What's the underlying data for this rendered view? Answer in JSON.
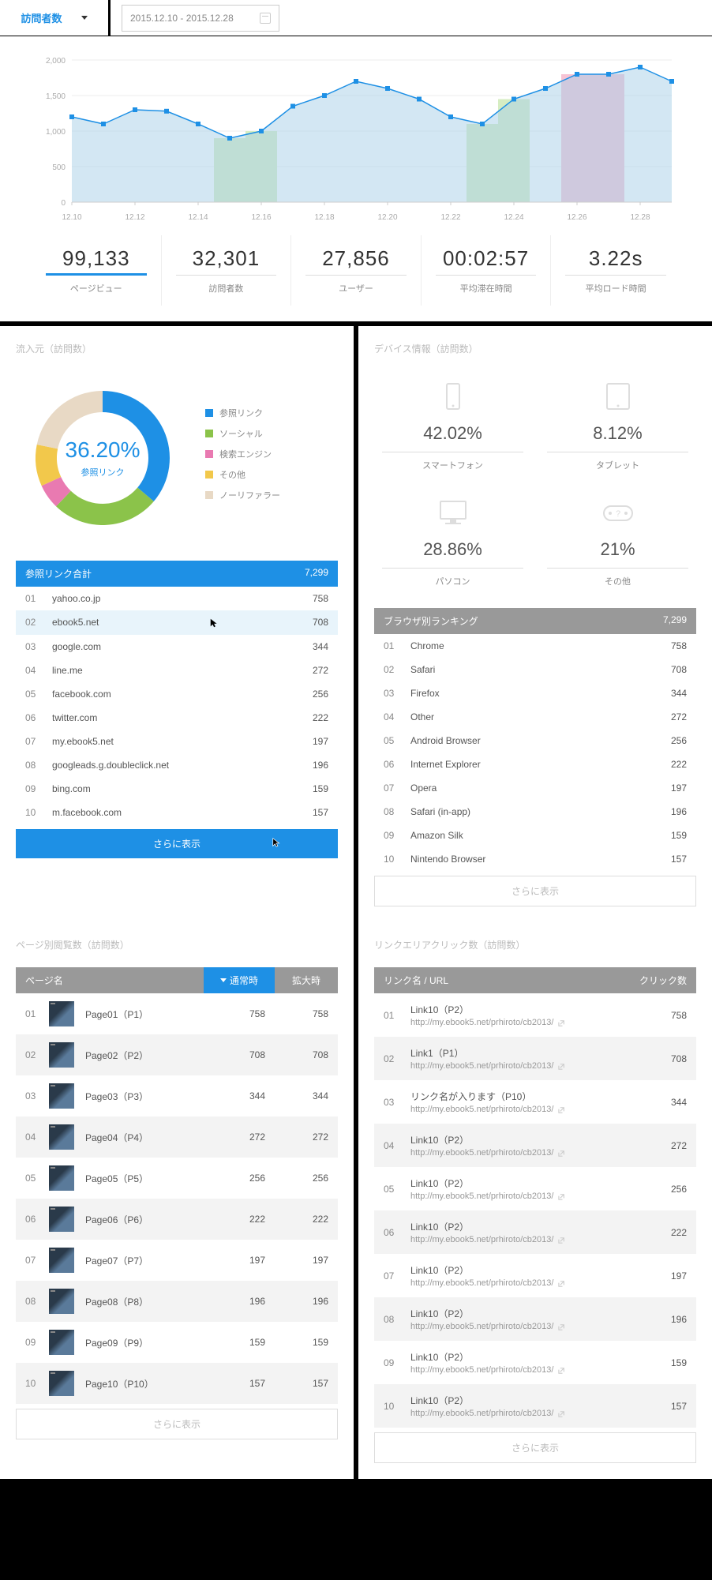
{
  "header": {
    "metric": "訪問者数",
    "daterange": "2015.12.10 - 2015.12.28"
  },
  "chart_data": {
    "type": "area",
    "x": [
      "12.10",
      "12.12",
      "12.14",
      "12.16",
      "12.18",
      "12.20",
      "12.22",
      "12.24",
      "12.26",
      "12.28"
    ],
    "series": [
      {
        "name": "main",
        "values": [
          1200,
          1100,
          1300,
          1280,
          1100,
          900,
          1000,
          1350,
          1500,
          1700,
          1600,
          1450,
          1200,
          1100,
          1450,
          1600,
          1800,
          1800,
          1900,
          1700
        ],
        "color": "#a7cfe8"
      },
      {
        "name": "hl1",
        "idx": [
          5,
          6
        ],
        "color": "#d6edc2"
      },
      {
        "name": "hl2",
        "idx": [
          13,
          14
        ],
        "color": "#d6edc2"
      },
      {
        "name": "hl3",
        "idx": [
          16,
          17
        ],
        "color": "#f7c3d4"
      }
    ],
    "ylim": [
      0,
      2000
    ],
    "yticks": [
      0,
      500,
      1000,
      1500,
      2000
    ]
  },
  "stats": [
    {
      "value": "99,133",
      "label": "ページビュー",
      "active": true
    },
    {
      "value": "32,301",
      "label": "訪問者数"
    },
    {
      "value": "27,856",
      "label": "ユーザー"
    },
    {
      "value": "00:02:57",
      "label": "平均滞在時間"
    },
    {
      "value": "3.22s",
      "label": "平均ロード時間"
    }
  ],
  "referral": {
    "title": "流入元（訪問数）",
    "center_pct": "36.20%",
    "center_label": "参照リンク",
    "segments": [
      {
        "label": "参照リンク",
        "color": "#1e90e5",
        "pct": 36.2
      },
      {
        "label": "ソーシャル",
        "color": "#8bc34a",
        "pct": 26
      },
      {
        "label": "検索エンジン",
        "color": "#e97ab1",
        "pct": 6
      },
      {
        "label": "その他",
        "color": "#f2c84b",
        "pct": 10
      },
      {
        "label": "ノーリファラー",
        "color": "#e8d9c5",
        "pct": 21.8
      }
    ],
    "table_head": {
      "label": "参照リンク合計",
      "total": "7,299"
    },
    "rows": [
      {
        "rank": "01",
        "name": "yahoo.co.jp",
        "val": "758"
      },
      {
        "rank": "02",
        "name": "ebook5.net",
        "val": "708",
        "hover": true
      },
      {
        "rank": "03",
        "name": "google.com",
        "val": "344"
      },
      {
        "rank": "04",
        "name": "line.me",
        "val": "272"
      },
      {
        "rank": "05",
        "name": "facebook.com",
        "val": "256"
      },
      {
        "rank": "06",
        "name": "twitter.com",
        "val": "222"
      },
      {
        "rank": "07",
        "name": "my.ebook5.net",
        "val": "197"
      },
      {
        "rank": "08",
        "name": "googleads.g.doubleclick.net",
        "val": "196"
      },
      {
        "rank": "09",
        "name": "bing.com",
        "val": "159"
      },
      {
        "rank": "10",
        "name": "m.facebook.com",
        "val": "157"
      }
    ],
    "more": "さらに表示"
  },
  "device": {
    "title": "デバイス情報（訪問数）",
    "items": [
      {
        "pct": "42.02%",
        "label": "スマートフォン",
        "icon": "phone"
      },
      {
        "pct": "8.12%",
        "label": "タブレット",
        "icon": "tablet"
      },
      {
        "pct": "28.86%",
        "label": "パソコン",
        "icon": "desktop"
      },
      {
        "pct": "21%",
        "label": "その他",
        "icon": "game"
      }
    ],
    "browser_head": {
      "label": "ブラウザ別ランキング",
      "total": "7,299"
    },
    "browsers": [
      {
        "rank": "01",
        "name": "Chrome",
        "val": "758"
      },
      {
        "rank": "02",
        "name": "Safari",
        "val": "708"
      },
      {
        "rank": "03",
        "name": "Firefox",
        "val": "344"
      },
      {
        "rank": "04",
        "name": "Other",
        "val": "272"
      },
      {
        "rank": "05",
        "name": "Android Browser",
        "val": "256"
      },
      {
        "rank": "06",
        "name": "Internet Explorer",
        "val": "222"
      },
      {
        "rank": "07",
        "name": "Opera",
        "val": "197"
      },
      {
        "rank": "08",
        "name": "Safari (in-app)",
        "val": "196"
      },
      {
        "rank": "09",
        "name": "Amazon Silk",
        "val": "159"
      },
      {
        "rank": "10",
        "name": "Nintendo Browser",
        "val": "157"
      }
    ],
    "more": "さらに表示"
  },
  "pages": {
    "title": "ページ別閲覧数（訪問数）",
    "head": {
      "c1": "ページ名",
      "c2": "通常時",
      "c3": "拡大時"
    },
    "rows": [
      {
        "rank": "01",
        "name": "Page01（P1）",
        "v1": "758",
        "v2": "758"
      },
      {
        "rank": "02",
        "name": "Page02（P2）",
        "v1": "708",
        "v2": "708"
      },
      {
        "rank": "03",
        "name": "Page03（P3）",
        "v1": "344",
        "v2": "344"
      },
      {
        "rank": "04",
        "name": "Page04（P4）",
        "v1": "272",
        "v2": "272"
      },
      {
        "rank": "05",
        "name": "Page05（P5）",
        "v1": "256",
        "v2": "256"
      },
      {
        "rank": "06",
        "name": "Page06（P6）",
        "v1": "222",
        "v2": "222"
      },
      {
        "rank": "07",
        "name": "Page07（P7）",
        "v1": "197",
        "v2": "197"
      },
      {
        "rank": "08",
        "name": "Page08（P8）",
        "v1": "196",
        "v2": "196"
      },
      {
        "rank": "09",
        "name": "Page09（P9）",
        "v1": "159",
        "v2": "159"
      },
      {
        "rank": "10",
        "name": "Page10（P10）",
        "v1": "157",
        "v2": "157"
      }
    ],
    "more": "さらに表示"
  },
  "links": {
    "title": "リンクエリアクリック数（訪問数）",
    "head": {
      "c1": "リンク名 / URL",
      "c2": "クリック数"
    },
    "rows": [
      {
        "rank": "01",
        "name": "Link10（P2）",
        "url": "http://my.ebook5.net/prhiroto/cb2013/",
        "val": "758"
      },
      {
        "rank": "02",
        "name": "Link1（P1）",
        "url": "http://my.ebook5.net/prhiroto/cb2013/",
        "val": "708"
      },
      {
        "rank": "03",
        "name": "リンク名が入ります（P10）",
        "url": "http://my.ebook5.net/prhiroto/cb2013/",
        "val": "344"
      },
      {
        "rank": "04",
        "name": "Link10（P2）",
        "url": "http://my.ebook5.net/prhiroto/cb2013/",
        "val": "272"
      },
      {
        "rank": "05",
        "name": "Link10（P2）",
        "url": "http://my.ebook5.net/prhiroto/cb2013/",
        "val": "256"
      },
      {
        "rank": "06",
        "name": "Link10（P2）",
        "url": "http://my.ebook5.net/prhiroto/cb2013/",
        "val": "222"
      },
      {
        "rank": "07",
        "name": "Link10（P2）",
        "url": "http://my.ebook5.net/prhiroto/cb2013/",
        "val": "197"
      },
      {
        "rank": "08",
        "name": "Link10（P2）",
        "url": "http://my.ebook5.net/prhiroto/cb2013/",
        "val": "196"
      },
      {
        "rank": "09",
        "name": "Link10（P2）",
        "url": "http://my.ebook5.net/prhiroto/cb2013/",
        "val": "159"
      },
      {
        "rank": "10",
        "name": "Link10（P2）",
        "url": "http://my.ebook5.net/prhiroto/cb2013/",
        "val": "157"
      }
    ],
    "more": "さらに表示"
  }
}
